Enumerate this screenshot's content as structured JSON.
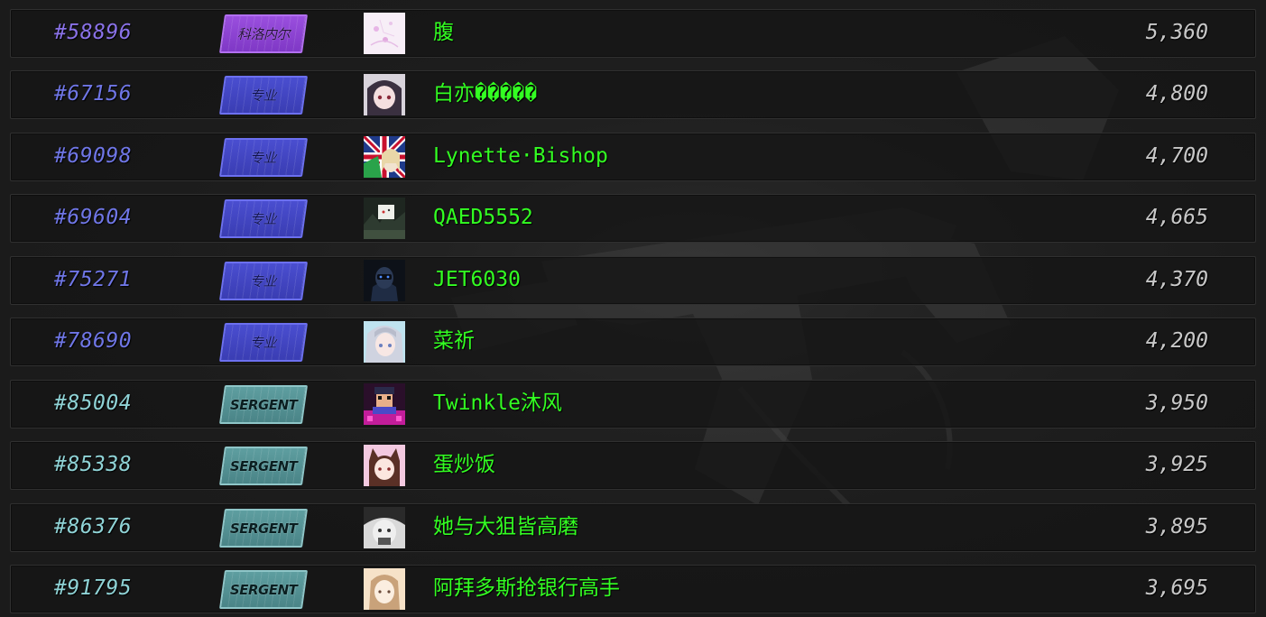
{
  "colors": {
    "rank_purple": "#8a72e8",
    "rank_blue": "#6f76e6",
    "rank_teal": "#8fd3d6",
    "name_green": "#33ff22",
    "score_gray": "#c8c8c8"
  },
  "rows": [
    {
      "rank": "#58896",
      "badge": {
        "label": "科洛内尔",
        "tier": "purple"
      },
      "avatar": "pink-sketch-avatar",
      "name": "腹",
      "score": "5,360"
    },
    {
      "rank": "#67156",
      "badge": {
        "label": "专业",
        "tier": "blue"
      },
      "avatar": "anime-girl-dark-hair-avatar",
      "name": "白亦�����",
      "score": "4,800"
    },
    {
      "rank": "#69098",
      "badge": {
        "label": "专业",
        "tier": "blue"
      },
      "avatar": "union-jack-anime-avatar",
      "name": "Lynette·Bishop",
      "score": "4,700"
    },
    {
      "rank": "#69604",
      "badge": {
        "label": "专业",
        "tier": "blue"
      },
      "avatar": "dark-forest-sign-avatar",
      "name": "QAED5552",
      "score": "4,665"
    },
    {
      "rank": "#75271",
      "badge": {
        "label": "专业",
        "tier": "blue"
      },
      "avatar": "soldier-dark-avatar",
      "name": "JET6030",
      "score": "4,370"
    },
    {
      "rank": "#78690",
      "badge": {
        "label": "专业",
        "tier": "blue"
      },
      "avatar": "anime-girl-silver-hair-avatar",
      "name": "菜祈",
      "score": "4,200"
    },
    {
      "rank": "#85004",
      "badge": {
        "label": "SERGENT",
        "tier": "teal"
      },
      "avatar": "pixel-character-magenta-avatar",
      "name": "Twinkle沐风",
      "score": "3,950"
    },
    {
      "rank": "#85338",
      "badge": {
        "label": "SERGENT",
        "tier": "teal"
      },
      "avatar": "catgirl-pink-avatar",
      "name": "蛋炒饭",
      "score": "3,925"
    },
    {
      "rank": "#86376",
      "badge": {
        "label": "SERGENT",
        "tier": "teal"
      },
      "avatar": "grayscale-face-avatar",
      "name": "她与大狙皆高磨",
      "score": "3,895"
    },
    {
      "rank": "#91795",
      "badge": {
        "label": "SERGENT",
        "tier": "teal"
      },
      "avatar": "girl-warm-tone-avatar",
      "name": "阿拜多斯抢银行高手",
      "score": "3,695"
    }
  ]
}
